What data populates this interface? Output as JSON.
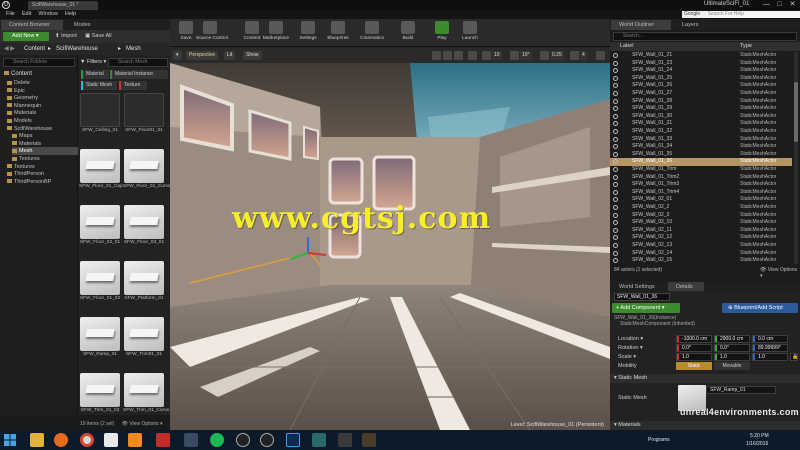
{
  "window": {
    "doc_tab": "ScifiWarehouse_01 *",
    "title": "UltimateSciFi_01",
    "min": "—",
    "max": "□",
    "close": "✕",
    "logo": "U"
  },
  "menu": [
    "File",
    "Edit",
    "Window",
    "Help"
  ],
  "google": {
    "label": "Google ▾",
    "placeholder": "Search For Help"
  },
  "content_browser": {
    "tabs": [
      "Content Browser",
      "Modes"
    ],
    "add_new": "Add New ▾",
    "import": "Import",
    "save_all": "Save All",
    "path": [
      "Content",
      "▸",
      "ScifiWarehouse",
      "▸",
      "Mesh"
    ],
    "search_folders": "Search Folders",
    "tree_title": "Content",
    "folders": [
      {
        "label": "Delete",
        "indent": 1
      },
      {
        "label": "Epic",
        "indent": 1
      },
      {
        "label": "Geometry",
        "indent": 1
      },
      {
        "label": "Mannequin",
        "indent": 1
      },
      {
        "label": "Materials",
        "indent": 1
      },
      {
        "label": "Models",
        "indent": 1
      },
      {
        "label": "ScifiWarehouse",
        "indent": 1
      },
      {
        "label": "Maps",
        "indent": 2
      },
      {
        "label": "Materials",
        "indent": 2
      },
      {
        "label": "Mesh",
        "indent": 2,
        "selected": true
      },
      {
        "label": "Textures",
        "indent": 2
      },
      {
        "label": "Textures",
        "indent": 1
      },
      {
        "label": "ThirdPerson",
        "indent": 1
      },
      {
        "label": "ThirdPersonBP",
        "indent": 1
      }
    ],
    "filters": "▼ Filters ▾",
    "search_mesh": "Search Mesh",
    "chips": [
      {
        "label": "Material",
        "color": "#1e9e44"
      },
      {
        "label": "Material Instance",
        "color": "#2c8c2c"
      },
      {
        "label": "Static Mesh",
        "color": "#18c4d2"
      },
      {
        "label": "Texture",
        "color": "#d23434"
      }
    ],
    "assets": [
      {
        "label": "SFW_Ceiling_01",
        "style": "dark"
      },
      {
        "label": "SFW_Floor01_01",
        "style": "dark"
      },
      {
        "label": "SFW_Floor_01_Cap",
        "style": "light"
      },
      {
        "label": "SFW_Floor_01_Curve_01",
        "style": "light"
      },
      {
        "label": "SFW_Floor_02_01",
        "style": "light"
      },
      {
        "label": "SFW_Floor_03_01",
        "style": "light"
      },
      {
        "label": "SFW_Floor_01_02",
        "style": "light"
      },
      {
        "label": "SFW_Platform_01",
        "style": "light"
      },
      {
        "label": "SFW_Ramp_01",
        "style": "light"
      },
      {
        "label": "SFW_Trim01_01",
        "style": "light"
      },
      {
        "label": "SFW_Trim_01_02",
        "style": "light"
      },
      {
        "label": "SFW_Trim_01_Curve_01",
        "style": "light"
      }
    ],
    "status": "19 items (2 sel)",
    "view_options": "👁 View Options ▾"
  },
  "toolbar": [
    {
      "label": "Save"
    },
    {
      "label": "Source Control"
    },
    {
      "label": "Content"
    },
    {
      "label": "Marketplace"
    },
    {
      "label": "Settings"
    },
    {
      "label": "Blueprints"
    },
    {
      "label": "Cinematics"
    },
    {
      "label": "Build"
    },
    {
      "label": "Play"
    },
    {
      "label": "Launch"
    }
  ],
  "viewport": {
    "perspective": "Perspective",
    "lit": "Lit",
    "show": "Show",
    "snap_values": [
      "10",
      "10°",
      "0.25",
      "4"
    ],
    "watermark": "www.cgtsj.com",
    "level": "Level:  ScifiWarehouse_01 (Persistent)"
  },
  "outliner": {
    "tabs": [
      "World Outliner",
      "Layers"
    ],
    "search": "Search...",
    "col_label": "Label",
    "col_type": "Type",
    "rows": [
      {
        "name": "SFW_Wall_01_21",
        "type": "StaticMeshActor"
      },
      {
        "name": "SFW_Wall_01_23",
        "type": "StaticMeshActor"
      },
      {
        "name": "SFW_Wall_01_24",
        "type": "StaticMeshActor"
      },
      {
        "name": "SFW_Wall_01_25",
        "type": "StaticMeshActor"
      },
      {
        "name": "SFW_Wall_01_26",
        "type": "StaticMeshActor"
      },
      {
        "name": "SFW_Wall_01_27",
        "type": "StaticMeshActor"
      },
      {
        "name": "SFW_Wall_01_28",
        "type": "StaticMeshActor"
      },
      {
        "name": "SFW_Wall_01_29",
        "type": "StaticMeshActor"
      },
      {
        "name": "SFW_Wall_01_30",
        "type": "StaticMeshActor"
      },
      {
        "name": "SFW_Wall_01_31",
        "type": "StaticMeshActor"
      },
      {
        "name": "SFW_Wall_01_32",
        "type": "StaticMeshActor"
      },
      {
        "name": "SFW_Wall_01_33",
        "type": "StaticMeshActor"
      },
      {
        "name": "SFW_Wall_01_34",
        "type": "StaticMeshActor"
      },
      {
        "name": "SFW_Wall_01_35",
        "type": "StaticMeshActor"
      },
      {
        "name": "SFW_Wall_01_36",
        "type": "StaticMeshActor",
        "selected": true
      },
      {
        "name": "SFW_Wall_01_Trim",
        "type": "StaticMeshActor"
      },
      {
        "name": "SFW_Wall_01_Trim2",
        "type": "StaticMeshActor"
      },
      {
        "name": "SFW_Wall_01_Trim3",
        "type": "StaticMeshActor"
      },
      {
        "name": "SFW_Wall_01_Trim4",
        "type": "StaticMeshActor"
      },
      {
        "name": "SFW_Wall_02_01",
        "type": "StaticMeshActor"
      },
      {
        "name": "SFW_Wall_02_2",
        "type": "StaticMeshActor"
      },
      {
        "name": "SFW_Wall_02_3",
        "type": "StaticMeshActor"
      },
      {
        "name": "SFW_Wall_02_10",
        "type": "StaticMeshActor"
      },
      {
        "name": "SFW_Wall_02_11",
        "type": "StaticMeshActor"
      },
      {
        "name": "SFW_Wall_02_12",
        "type": "StaticMeshActor"
      },
      {
        "name": "SFW_Wall_02_13",
        "type": "StaticMeshActor"
      },
      {
        "name": "SFW_Wall_02_14",
        "type": "StaticMeshActor"
      },
      {
        "name": "SFW_Wall_02_15",
        "type": "StaticMeshActor"
      }
    ],
    "status": "84 actors (1 selected)",
    "view_options": "👁 View Options ▾"
  },
  "details": {
    "tabs": [
      "World Settings",
      "Details"
    ],
    "name_value": "SFW_Wall_01_36",
    "add_component": "+ Add Component ▾",
    "blueprint": "⊕ Blueprint/Add Script",
    "component": "SFW_Wall_01_36(Instance)",
    "component_sub": "StaticMeshComponent (Inherited)",
    "location_label": "Location ▾",
    "rotation_label": "Rotation ▾",
    "scale_label": "Scale ▾",
    "mobility_label": "Mobility",
    "location": [
      "-1000.0 cm",
      "2900.0 cm",
      "0.0 cm"
    ],
    "rotation": [
      "0.0°",
      "0.0°",
      "89.99999°"
    ],
    "scale": [
      "1.0",
      "1.0",
      "1.0"
    ],
    "static": "Static",
    "movable": "Movable",
    "static_mesh_header": "▾ Static Mesh",
    "static_mesh_label": "Static Mesh",
    "static_mesh_value": "SFW_Ramp_01",
    "materials_header": "▾ Materials",
    "site_watermark": "unreal4environments.com"
  },
  "taskbar": {
    "programs": "Programs",
    "time": "5:20 PM",
    "date": "1/16/2016"
  },
  "colors": {
    "accent_green": "#3c8b2e",
    "selection": "#b79463",
    "blueprint_blue": "#2c5a9b",
    "watermark": "#f6ee2a"
  }
}
